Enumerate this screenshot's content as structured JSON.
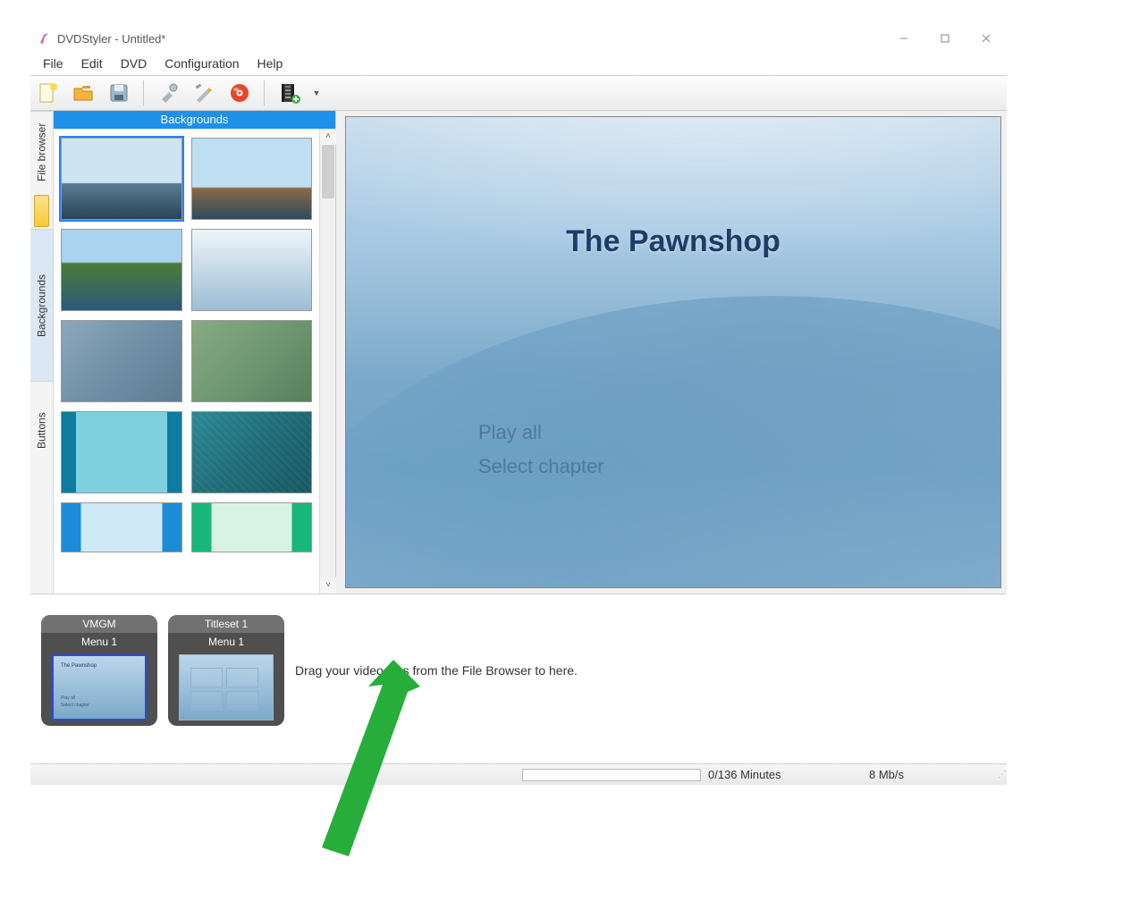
{
  "window": {
    "title": "DVDStyler - Untitled*"
  },
  "menubar": {
    "file": "File",
    "edit": "Edit",
    "dvd": "DVD",
    "configuration": "Configuration",
    "help": "Help"
  },
  "toolbar": {
    "new": "New",
    "open": "Open",
    "save": "Save",
    "settings": "Settings",
    "options": "Options",
    "burn": "Burn",
    "add": "Add"
  },
  "side_tabs": {
    "file_browser": "File browser",
    "backgrounds": "Backgrounds",
    "buttons": "Buttons"
  },
  "sidebar": {
    "panel_header": "Backgrounds"
  },
  "preview": {
    "title": "The Pawnshop",
    "play_all": "Play all",
    "select_chapter": "Select chapter"
  },
  "timeline": {
    "vmgm": {
      "group": "VMGM",
      "label": "Menu 1",
      "mini_title": "The Pawnshop",
      "mini_l1": "Play all",
      "mini_l2": "Select chapter"
    },
    "titleset1": {
      "group": "Titleset 1",
      "label": "Menu 1"
    },
    "drag_hint": "Drag your video files from the File Browser to here."
  },
  "statusbar": {
    "time": "0/136 Minutes",
    "rate": "8 Mb/s"
  }
}
